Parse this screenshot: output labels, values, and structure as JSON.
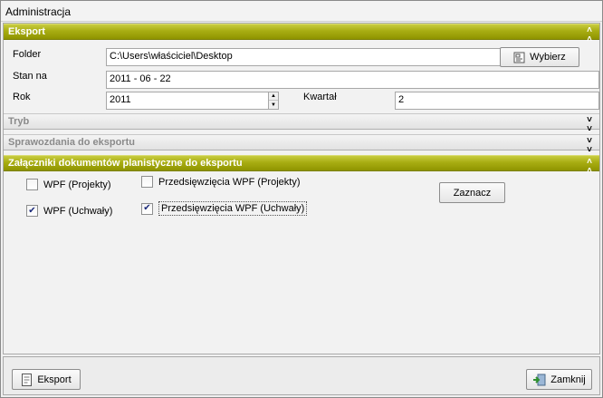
{
  "window": {
    "title": "Administracja"
  },
  "eksport_section": {
    "title": "Eksport",
    "folder_label": "Folder",
    "folder_value": "C:\\Users\\właściciel\\Desktop",
    "browse_button": "Wybierz",
    "stan_label": "Stan na",
    "stan_value": "2011 - 06 - 22",
    "rok_label": "Rok",
    "rok_value": "2011",
    "kwartal_label": "Kwartał",
    "kwartal_value": "2"
  },
  "tryb_section": {
    "title": "Tryb"
  },
  "sprawozdania_section": {
    "title": "Sprawozdania do eksportu"
  },
  "zalaczniki_section": {
    "title": "Załączniki dokumentów planistyczne do eksportu",
    "checkboxes": [
      {
        "label": "WPF (Projekty)",
        "checked": false
      },
      {
        "label": "WPF (Uchwały)",
        "checked": true
      },
      {
        "label": "Przedsięwzięcia WPF (Projekty)",
        "checked": false
      },
      {
        "label": "Przedsięwzięcia WPF (Uchwały)",
        "checked": true
      }
    ],
    "select_button": "Zaznacz"
  },
  "footer": {
    "export_button": "Eksport",
    "close_button": "Zamknij"
  },
  "colors": {
    "active_header": "#a8ad12",
    "collapsed_header": "#e2e2e2"
  },
  "icons": {
    "collapse": "double-chevron-up-icon",
    "expand": "double-chevron-down-icon",
    "browse": "folder-browse-icon",
    "export": "export-document-icon",
    "close": "exit-door-icon"
  }
}
